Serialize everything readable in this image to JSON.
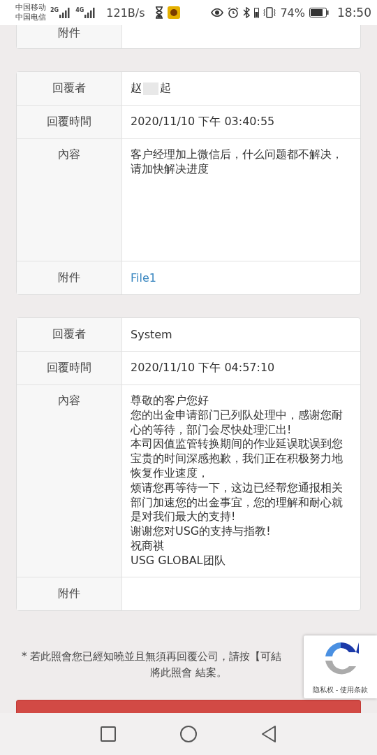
{
  "status_bar": {
    "carriers": [
      "中国移动",
      "中国电信"
    ],
    "network_labels": [
      "2G",
      "4G"
    ],
    "speed": "121B/s",
    "battery_percent": "74%",
    "time": "18:50"
  },
  "cards": [
    {
      "rows": [
        {
          "kind": "empty",
          "label": "附件"
        }
      ]
    },
    {
      "rows": [
        {
          "kind": "name",
          "label": "回覆者",
          "value_parts": [
            "赵",
            "起"
          ]
        },
        {
          "kind": "text",
          "label": "回覆時間",
          "value": "2020/11/10 下午 03:40:55"
        },
        {
          "kind": "content",
          "label": "內容",
          "lines": [
            "客户经理加上微信后，什么问题都不解决，请加快解决进度"
          ]
        },
        {
          "kind": "link",
          "label": "附件",
          "value": "File1"
        }
      ]
    },
    {
      "rows": [
        {
          "kind": "text",
          "label": "回覆者",
          "value": "System"
        },
        {
          "kind": "text",
          "label": "回覆時間",
          "value": "2020/11/10 下午 04:57:10"
        },
        {
          "kind": "content",
          "label": "內容",
          "lines": [
            "尊敬的客户您好",
            "您的出金申请部门已列队处理中，感谢您耐心的等待，部门会尽快处理汇出!",
            "本司因值监管转换期间的作业延误耽误到您宝贵的时间深感抱歉，我们正在积极努力地恢复作业速度，",
            "烦请您再等待一下，这边已经帮您通报相关部门加速您的出金事宜，您的理解和耐心就是对我们最大的支持!",
            "谢谢您对USG的支持与指教!",
            "祝商祺",
            "USG GLOBAL团队"
          ]
        },
        {
          "kind": "empty",
          "label": "附件"
        }
      ]
    }
  ],
  "footnote": [
    "* 若此照會您已經知曉並且無須再回覆公司，請按【可結",
    "將此照會 結案。"
  ],
  "recaptcha": {
    "links": "隐私权 - 使用条款"
  }
}
